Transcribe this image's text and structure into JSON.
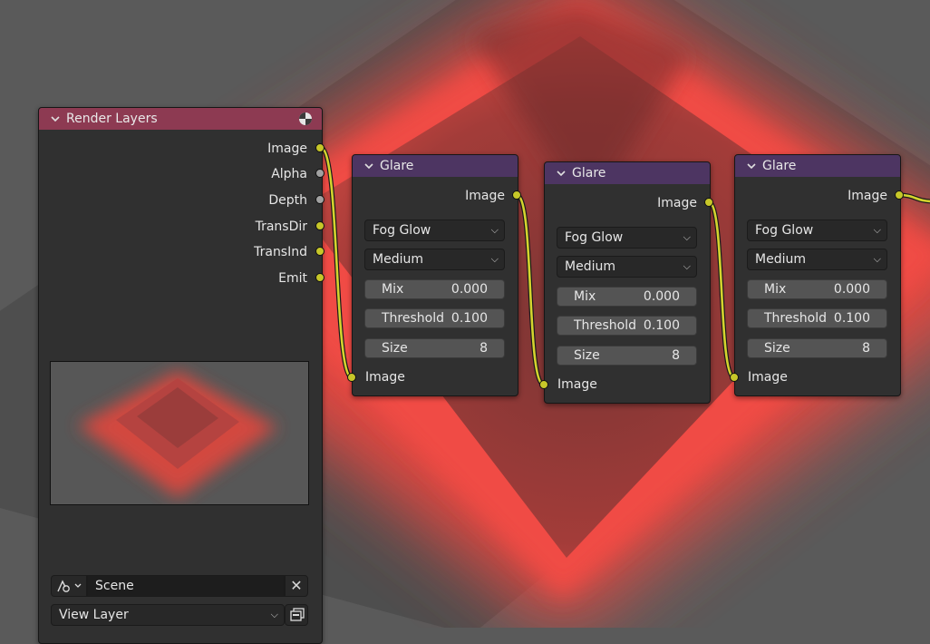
{
  "colors": {
    "input_header": "#8d3a52",
    "filter_header": "#4d3562",
    "color_socket": "#c7c729",
    "value_socket": "#a1a1a1",
    "link": "#d4d42e",
    "backdrop_red": "#e8463f",
    "backdrop_gray": "#5a5a5a"
  },
  "render_layers": {
    "title": "Render Layers",
    "icon": "render-result-icon",
    "outputs": [
      {
        "label": "Image",
        "type": "color"
      },
      {
        "label": "Alpha",
        "type": "value"
      },
      {
        "label": "Depth",
        "type": "value"
      },
      {
        "label": "TransDir",
        "type": "color"
      },
      {
        "label": "TransInd",
        "type": "color"
      },
      {
        "label": "Emit",
        "type": "color"
      }
    ],
    "scene_icon": "scene-icon",
    "scene": "Scene",
    "clear_icon": "close-icon",
    "view_layer": "View Layer",
    "view_layer_icon": "render-layer-icon"
  },
  "glare_nodes": [
    {
      "title": "Glare",
      "output": "Image",
      "glare_type": "Fog Glow",
      "quality": "Medium",
      "mix_label": "Mix",
      "mix": "0.000",
      "threshold_label": "Threshold",
      "threshold": "0.100",
      "size_label": "Size",
      "size": "8",
      "input": "Image"
    },
    {
      "title": "Glare",
      "output": "Image",
      "glare_type": "Fog Glow",
      "quality": "Medium",
      "mix_label": "Mix",
      "mix": "0.000",
      "threshold_label": "Threshold",
      "threshold": "0.100",
      "size_label": "Size",
      "size": "8",
      "input": "Image"
    },
    {
      "title": "Glare",
      "output": "Image",
      "glare_type": "Fog Glow",
      "quality": "Medium",
      "mix_label": "Mix",
      "mix": "0.000",
      "threshold_label": "Threshold",
      "threshold": "0.100",
      "size_label": "Size",
      "size": "8",
      "input": "Image"
    }
  ]
}
